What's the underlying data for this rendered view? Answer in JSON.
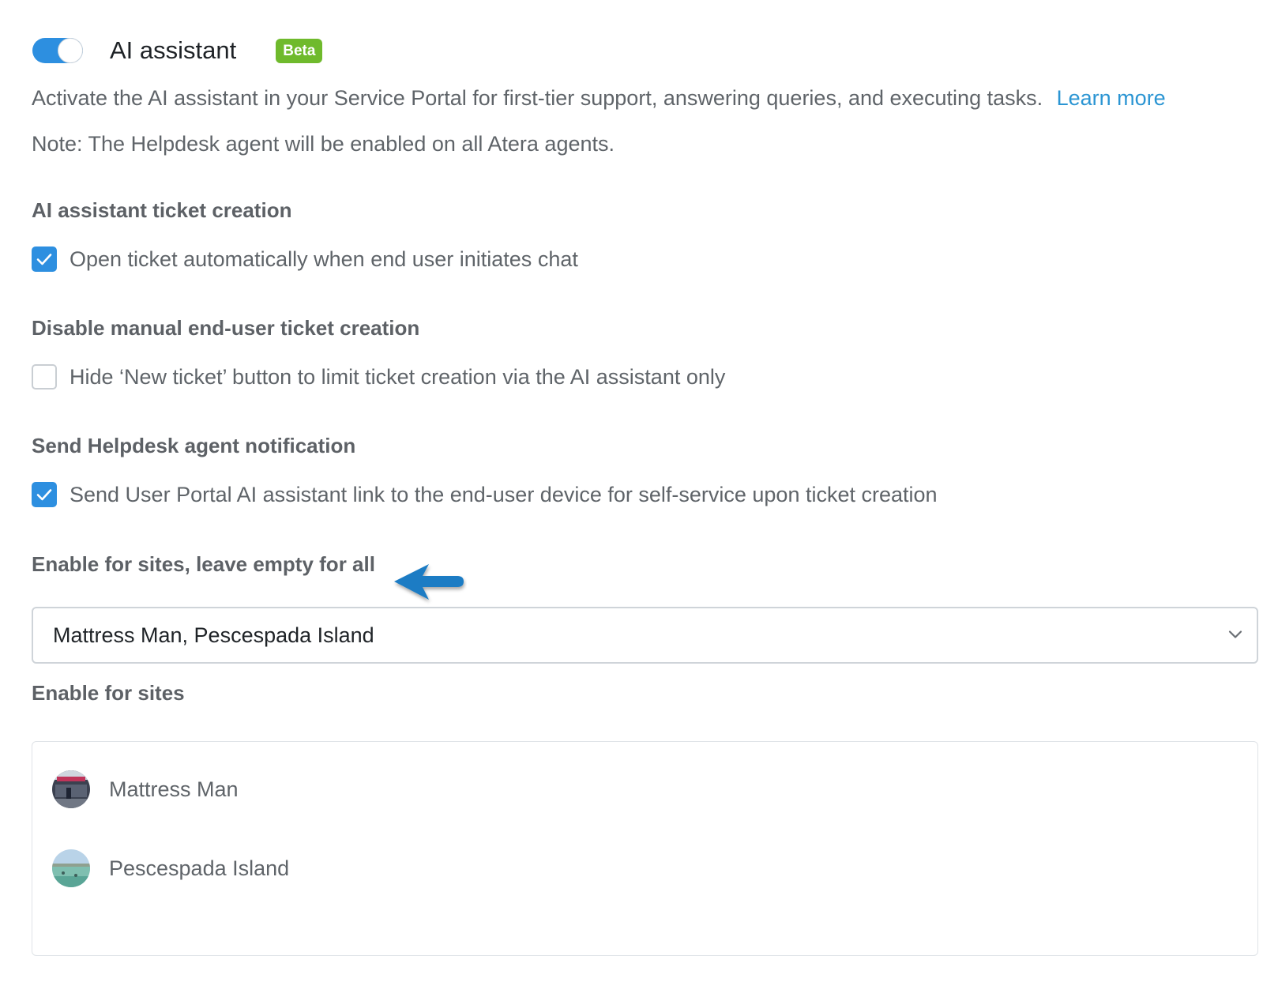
{
  "header": {
    "toggle_state": "on",
    "title": "AI assistant",
    "badge": "Beta"
  },
  "description": {
    "text": "Activate the AI assistant in your Service Portal for first-tier support, answering queries, and executing tasks.",
    "link": "Learn more"
  },
  "note": "Note: The Helpdesk agent will be enabled on all Atera agents.",
  "sections": [
    {
      "title": "AI assistant ticket creation",
      "checkbox_label": "Open ticket automatically when end user initiates chat",
      "checked": true
    },
    {
      "title": "Disable manual end-user ticket creation",
      "checkbox_label": "Hide ‘New ticket’ button to limit ticket creation via the AI assistant only",
      "checked": false
    },
    {
      "title": "Send Helpdesk agent notification",
      "checkbox_label": "Send User Portal AI assistant link to the end-user device for self-service upon ticket creation",
      "checked": true
    }
  ],
  "sites_select": {
    "label": "Enable for sites, leave empty for all",
    "value": "Mattress Man, Pescespada Island",
    "icon": "chevron-down-icon"
  },
  "sites_list": {
    "label": "Enable for sites",
    "items": [
      {
        "name": "Mattress Man"
      },
      {
        "name": "Pescespada Island"
      }
    ]
  },
  "colors": {
    "accent": "#2d8fe0",
    "link": "#2b95d3",
    "badge": "#6fba2c",
    "annotation_arrow": "#1b7bc4"
  }
}
